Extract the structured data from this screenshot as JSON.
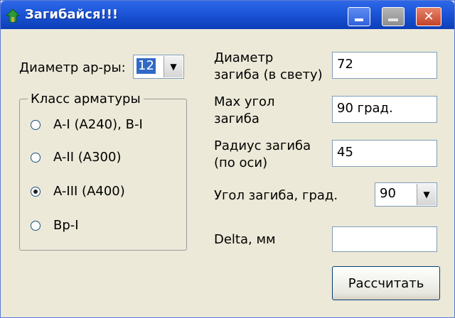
{
  "window": {
    "title": "Загибайся!!!"
  },
  "diameter_bar": {
    "label": "Диаметр ар-ры:",
    "value": "12"
  },
  "rebar_class": {
    "title": "Класс арматуры",
    "options": [
      {
        "label": "A-I (A240), B-I",
        "checked": false
      },
      {
        "label": "A-II (A300)",
        "checked": false
      },
      {
        "label": "A-III (A400)",
        "checked": true
      },
      {
        "label": "Bp-I",
        "checked": false
      }
    ]
  },
  "fields": {
    "bend_diameter": {
      "label_line1": "Диаметр",
      "label_line2": "загиба (в свету)",
      "value": "72"
    },
    "max_angle": {
      "label_line1": "Max угол",
      "label_line2": "загиба",
      "value": "90 град."
    },
    "bend_radius": {
      "label_line1": "Радиус загиба",
      "label_line2": "(по оси)",
      "value": "45"
    },
    "bend_angle": {
      "label": "Угол загиба, град.",
      "value": "90"
    },
    "delta": {
      "label": "Delta, мм",
      "value": ""
    }
  },
  "buttons": {
    "calculate": "Расcчитать"
  },
  "icons": {
    "app": "house-arrow-icon",
    "minimize": "minimize-icon",
    "maximize": "maximize-icon",
    "close": "close-icon",
    "dropdown": "chevron-down-icon"
  }
}
